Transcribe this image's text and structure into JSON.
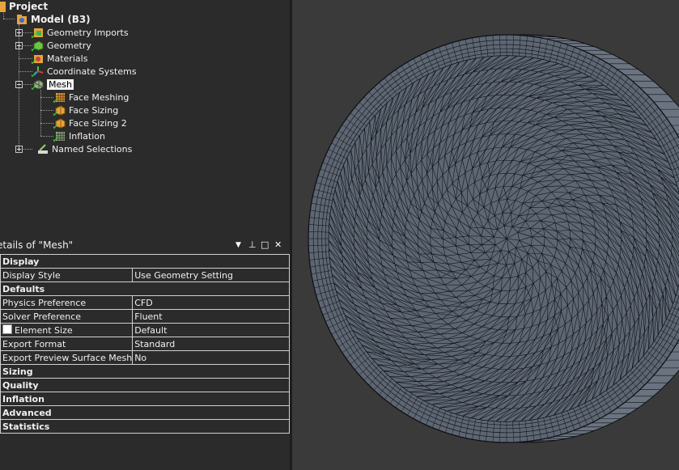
{
  "tree": {
    "root": "Project",
    "model": "Model (B3)",
    "items": [
      {
        "label": "Geometry Imports",
        "icon": "geometry-imports-icon"
      },
      {
        "label": "Geometry",
        "icon": "geometry-icon"
      },
      {
        "label": "Materials",
        "icon": "materials-icon"
      },
      {
        "label": "Coordinate Systems",
        "icon": "coordinate-systems-icon"
      },
      {
        "label": "Mesh",
        "icon": "mesh-icon"
      },
      {
        "label": "Named Selections",
        "icon": "named-selections-icon"
      }
    ],
    "mesh_children": [
      {
        "label": "Face Meshing",
        "icon": "face-meshing-icon"
      },
      {
        "label": "Face Sizing",
        "icon": "face-sizing-icon"
      },
      {
        "label": "Face Sizing 2",
        "icon": "face-sizing-icon"
      },
      {
        "label": "Inflation",
        "icon": "inflation-icon"
      }
    ]
  },
  "details": {
    "title": "etails of \"Mesh\"",
    "controls": {
      "dropdown": "▼",
      "pin": "⊥",
      "restore": "□",
      "close": "✕"
    },
    "rows": [
      {
        "type": "header",
        "label": "Display"
      },
      {
        "type": "prop",
        "label": "Display Style",
        "value": "Use Geometry Setting"
      },
      {
        "type": "header",
        "label": "Defaults"
      },
      {
        "type": "prop",
        "label": "Physics Preference",
        "value": "CFD"
      },
      {
        "type": "prop",
        "label": "Solver Preference",
        "value": "Fluent"
      },
      {
        "type": "prop",
        "label": "Element Size",
        "value": "Default",
        "checkbox": true
      },
      {
        "type": "prop",
        "label": "Export Format",
        "value": "Standard"
      },
      {
        "type": "prop",
        "label": "Export Preview Surface Mesh",
        "value": "No"
      },
      {
        "type": "header",
        "label": "Sizing"
      },
      {
        "type": "header",
        "label": "Quality"
      },
      {
        "type": "header",
        "label": "Inflation"
      },
      {
        "type": "header",
        "label": "Advanced"
      },
      {
        "type": "header",
        "label": "Statistics"
      }
    ]
  },
  "colors": {
    "panel_bg": "#2b2b2b",
    "viewport_bg": "#3a3a3a",
    "mesh_fill": "#5d6672",
    "mesh_line": "#0c0f14",
    "check_green": "#2fd52f",
    "folder_orange": "#e8a33c"
  }
}
